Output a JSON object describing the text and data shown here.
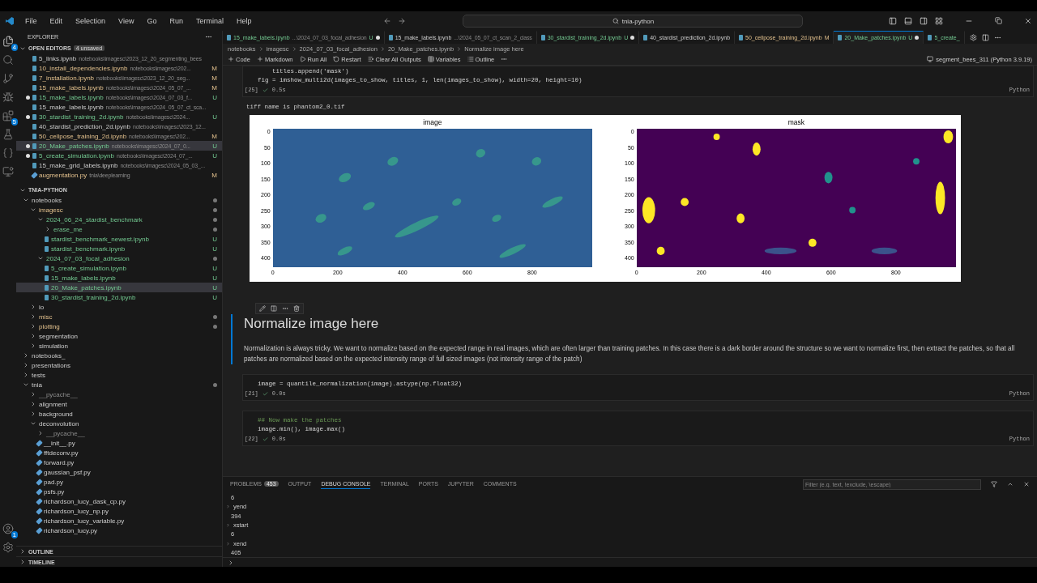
{
  "menu": [
    "File",
    "Edit",
    "Selection",
    "View",
    "Go",
    "Run",
    "Terminal",
    "Help"
  ],
  "search": "tnia-python",
  "activity": [
    {
      "kind": "files",
      "badge": "4",
      "selected": true
    },
    {
      "kind": "search",
      "selected": false
    },
    {
      "kind": "git",
      "selected": false
    },
    {
      "kind": "debug",
      "selected": false
    },
    {
      "kind": "extensions",
      "badge": "5",
      "selected": false
    },
    {
      "kind": "testing",
      "selected": false
    },
    {
      "kind": "json",
      "selected": false
    },
    {
      "kind": "remote",
      "selected": false
    }
  ],
  "activity_bottom": [
    {
      "kind": "account",
      "badge": "1"
    },
    {
      "kind": "settings"
    }
  ],
  "explorer": {
    "title": "EXPLORER",
    "open_editors": {
      "title": "OPEN EDITORS",
      "badge": "4 unsaved",
      "items": [
        {
          "name": "5_links.ipynb",
          "path": "notebooks\\imagesc\\2023_12_20_segmenting_bees",
          "kind": "notebook",
          "unsaved": false,
          "selected": false,
          "untracked": false,
          "modified": false
        },
        {
          "name": "10_install_dependencies.ipynb",
          "path": "notebooks\\imagesc\\202...",
          "status": "M",
          "kind": "notebook",
          "unsaved": false,
          "selected": false,
          "untracked": false,
          "modified": true
        },
        {
          "name": "7_installation.ipynb",
          "path": "notebooks\\imagesc\\2023_12_20_seg...",
          "status": "M",
          "kind": "notebook",
          "unsaved": false,
          "selected": false,
          "untracked": false,
          "modified": true
        },
        {
          "name": "15_make_labels.ipynb",
          "path": "notebooks\\imagesc\\2024_05_07_...",
          "status": "M",
          "kind": "notebook",
          "unsaved": false,
          "selected": false,
          "untracked": false,
          "modified": true
        },
        {
          "name": "15_make_labels.ipynb",
          "path": "notebooks\\imagesc\\2024_07_03_f...",
          "status": "U",
          "kind": "notebook",
          "unsaved": true,
          "selected": false,
          "untracked": true
        },
        {
          "name": "15_make_labels.ipynb",
          "path": "notebooks\\imagesc\\2024_05_07_ct_sca...",
          "kind": "notebook",
          "unsaved": false,
          "selected": false,
          "untracked": false,
          "modified": false
        },
        {
          "name": "30_stardist_training_2d.ipynb",
          "path": "notebooks\\imagesc\\2024...",
          "status": "U",
          "kind": "notebook",
          "unsaved": true,
          "selected": false,
          "untracked": true
        },
        {
          "name": "40_stardist_prediction_2d.ipynb",
          "path": "notebooks\\imagesc\\2023_12...",
          "kind": "notebook",
          "unsaved": false,
          "selected": false,
          "untracked": false,
          "modified": false
        },
        {
          "name": "50_cellpose_training_2d.ipynb",
          "path": "notebooks\\imagesc\\202...",
          "status": "M",
          "kind": "notebook",
          "unsaved": false,
          "selected": false,
          "untracked": false,
          "modified": true
        },
        {
          "name": "20_Make_patches.ipynb",
          "path": "notebooks\\imagesc\\2024_07_0...",
          "status": "U",
          "kind": "notebook",
          "unsaved": true,
          "selected": true,
          "untracked": true
        },
        {
          "name": "5_create_simulation.ipynb",
          "path": "notebooks\\imagesc\\2024_07_...",
          "status": "U",
          "kind": "notebook",
          "unsaved": true,
          "selected": false,
          "untracked": true
        },
        {
          "name": "15_make_grid_labels.ipynb",
          "path": "notebooks\\imagesc\\2024_05_03_...",
          "kind": "notebook",
          "unsaved": false,
          "selected": false,
          "untracked": false,
          "modified": false
        },
        {
          "name": "augmentation.py",
          "path": "tnia\\deeplearning",
          "status": "M",
          "kind": "python",
          "unsaved": false,
          "selected": false,
          "untracked": false,
          "modified": true
        }
      ]
    },
    "project": {
      "title": "TNIA-PYTHON",
      "tree": [
        {
          "name": "notebooks",
          "kind": "folder",
          "expanded": true,
          "dot": true,
          "untracked": false,
          "modified": false,
          "ignored": false,
          "selected": false,
          "children": [
            {
              "name": "imagesc",
              "kind": "folder",
              "expanded": true,
              "dot": true,
              "untracked": false,
              "modified": true,
              "selected": false,
              "children": [
                {
                  "name": "2024_06_24_stardist_benchmark",
                  "kind": "folder",
                  "expanded": true,
                  "dot": true,
                  "untracked": true,
                  "selected": false,
                  "children": [
                    {
                      "name": "erase_me",
                      "kind": "folder",
                      "expanded": false,
                      "dot": true,
                      "untracked": true,
                      "selected": false
                    },
                    {
                      "name": "stardist_benchmark_newest.ipynb",
                      "kind": "notebook",
                      "status": "U",
                      "untracked": true,
                      "selected": false
                    },
                    {
                      "name": "stardist_benchmark.ipynb",
                      "kind": "notebook",
                      "status": "U",
                      "untracked": true,
                      "selected": false
                    }
                  ]
                },
                {
                  "name": "2024_07_03_focal_adhesion",
                  "kind": "folder",
                  "expanded": true,
                  "dot": true,
                  "untracked": true,
                  "selected": false,
                  "children": [
                    {
                      "name": "5_create_simulation.ipynb",
                      "kind": "notebook",
                      "status": "U",
                      "untracked": true,
                      "selected": false
                    },
                    {
                      "name": "15_make_labels.ipynb",
                      "kind": "notebook",
                      "status": "U",
                      "untracked": true,
                      "selected": false
                    },
                    {
                      "name": "20_Make_patches.ipynb",
                      "kind": "notebook",
                      "status": "U",
                      "untracked": true,
                      "selected": true
                    },
                    {
                      "name": "30_stardist_training_2d.ipynb",
                      "kind": "notebook",
                      "status": "U",
                      "untracked": true,
                      "selected": false
                    }
                  ]
                }
              ]
            },
            {
              "name": "io",
              "kind": "folder",
              "expanded": false,
              "dot": false,
              "untracked": false,
              "modified": false,
              "ignored": false,
              "selected": false
            },
            {
              "name": "misc",
              "kind": "folder",
              "expanded": false,
              "dot": true,
              "untracked": false,
              "modified": true,
              "selected": false
            },
            {
              "name": "plotting",
              "kind": "folder",
              "expanded": false,
              "dot": true,
              "untracked": false,
              "modified": true,
              "selected": false
            },
            {
              "name": "segmentation",
              "kind": "folder",
              "expanded": false,
              "dot": false,
              "untracked": false,
              "modified": false,
              "ignored": false,
              "selected": false
            },
            {
              "name": "simulation",
              "kind": "folder",
              "expanded": false,
              "dot": false,
              "untracked": false,
              "modified": false,
              "ignored": false,
              "selected": false
            }
          ]
        },
        {
          "name": "notebooks_",
          "kind": "folder",
          "expanded": false,
          "dot": false,
          "untracked": false,
          "modified": false,
          "ignored": false,
          "selected": false
        },
        {
          "name": "presentations",
          "kind": "folder",
          "expanded": false,
          "dot": false,
          "untracked": false,
          "modified": false,
          "ignored": false,
          "selected": false
        },
        {
          "name": "tests",
          "kind": "folder",
          "expanded": false,
          "dot": false,
          "untracked": false,
          "modified": false,
          "ignored": false,
          "selected": false
        },
        {
          "name": "tnia",
          "kind": "folder",
          "expanded": true,
          "dot": true,
          "untracked": false,
          "modified": false,
          "ignored": false,
          "selected": false,
          "children": [
            {
              "name": "__pycache__",
              "kind": "folder",
              "expanded": false,
              "dot": false,
              "untracked": false,
              "modified": false,
              "ignored": true,
              "selected": false
            },
            {
              "name": "alignment",
              "kind": "folder",
              "expanded": false,
              "dot": false,
              "untracked": false,
              "modified": false,
              "ignored": false,
              "selected": false
            },
            {
              "name": "background",
              "kind": "folder",
              "expanded": false,
              "dot": false,
              "untracked": false,
              "modified": false,
              "ignored": false,
              "selected": false
            },
            {
              "name": "deconvolution",
              "kind": "folder",
              "expanded": true,
              "dot": false,
              "untracked": false,
              "modified": false,
              "ignored": false,
              "selected": false,
              "children": [
                {
                  "name": "__pycache__",
                  "kind": "folder",
                  "expanded": false,
                  "dot": false,
                  "untracked": false,
                  "modified": false,
                  "ignored": true,
                  "selected": false
                },
                {
                  "name": "__init__.py",
                  "kind": "python",
                  "untracked": false,
                  "modified": false,
                  "ignored": false,
                  "selected": false
                },
                {
                  "name": "fftdeconv.py",
                  "kind": "python",
                  "untracked": false,
                  "modified": false,
                  "ignored": false,
                  "selected": false
                },
                {
                  "name": "forward.py",
                  "kind": "python",
                  "untracked": false,
                  "modified": false,
                  "ignored": false,
                  "selected": false
                },
                {
                  "name": "gaussian_psf.py",
                  "kind": "python",
                  "untracked": false,
                  "modified": false,
                  "ignored": false,
                  "selected": false
                },
                {
                  "name": "pad.py",
                  "kind": "python",
                  "untracked": false,
                  "modified": false,
                  "ignored": false,
                  "selected": false
                },
                {
                  "name": "psfs.py",
                  "kind": "python",
                  "untracked": false,
                  "modified": false,
                  "ignored": false,
                  "selected": false
                },
                {
                  "name": "richardson_lucy_dask_cp.py",
                  "kind": "python",
                  "untracked": false,
                  "modified": false,
                  "ignored": false,
                  "selected": false
                },
                {
                  "name": "richardson_lucy_np.py",
                  "kind": "python",
                  "untracked": false,
                  "modified": false,
                  "ignored": false,
                  "selected": false
                },
                {
                  "name": "richardson_lucy_variable.py",
                  "kind": "python",
                  "untracked": false,
                  "modified": false,
                  "ignored": false,
                  "selected": false
                },
                {
                  "name": "richardson_lucy.py",
                  "kind": "python",
                  "untracked": false,
                  "modified": false,
                  "ignored": false,
                  "selected": false
                }
              ]
            }
          ]
        }
      ]
    },
    "outline": "OUTLINE",
    "timeline": "TIMELINE"
  },
  "tabs": [
    {
      "label": "15_make_labels.ipynb",
      "path": "...\\2024_07_03_focal_adhesion",
      "status": "U",
      "unsaved": true,
      "selected": false,
      "untracked": true
    },
    {
      "label": "15_make_labels.ipynb",
      "path": "...\\2024_05_07_ct_scan_2_class",
      "unsaved": false,
      "selected": false,
      "untracked": false,
      "modified": false
    },
    {
      "label": "30_stardist_training_2d.ipynb",
      "status": "U",
      "unsaved": true,
      "selected": false,
      "untracked": true
    },
    {
      "label": "40_stardist_prediction_2d.ipynb",
      "unsaved": false,
      "selected": false,
      "untracked": false,
      "modified": false
    },
    {
      "label": "50_cellpose_training_2d.ipynb",
      "status": "M",
      "unsaved": false,
      "selected": false,
      "untracked": false,
      "modified": true
    },
    {
      "label": "20_Make_patches.ipynb",
      "status": "U",
      "unsaved": true,
      "selected": true,
      "untracked": true
    },
    {
      "label": "5_create_",
      "unsaved": false,
      "selected": false,
      "untracked": true
    }
  ],
  "breadcrumb": [
    "notebooks",
    "imagesc",
    "2024_07_03_focal_adhesion",
    "20_Make_patches.ipynb",
    "Normalize image here"
  ],
  "toolbar": [
    {
      "kind": "add",
      "label": "Code"
    },
    {
      "kind": "add",
      "label": "Markdown"
    },
    {
      "kind": "run",
      "label": "Run All"
    },
    {
      "kind": "restart",
      "label": "Restart"
    },
    {
      "kind": "clear",
      "label": "Clear All Outputs"
    },
    {
      "kind": "variables",
      "label": "Variables"
    },
    {
      "kind": "outline",
      "label": "Outline"
    }
  ],
  "kernel": "segment_bees_311 (Python 3.9.19)",
  "cells": [
    {
      "kind": "code",
      "lines": [
        "    titles.append('mask')",
        "fig = imshow_multi2d(images_to_show, titles, 1, len(images_to_show), width=20, height=10)"
      ],
      "count": "[25]",
      "time": "0.5s",
      "language": "Python",
      "output": "tiff name is phantom2_0.tif",
      "figure": [
        {
          "title": "image",
          "yticks": [
            "0",
            "50",
            "100",
            "150",
            "200",
            "250",
            "300",
            "350",
            "400"
          ],
          "xticks": [
            "0",
            "200",
            "400",
            "600",
            "800"
          ]
        },
        {
          "title": "mask",
          "kind": "mask",
          "yticks": [
            "0",
            "50",
            "100",
            "150",
            "200",
            "250",
            "300",
            "350",
            "400"
          ],
          "xticks": [
            "0",
            "200",
            "400",
            "600",
            "800"
          ]
        }
      ]
    },
    {
      "kind": "markdown",
      "heading": "Normalize image here",
      "text": "Normalization is always tricky. We want to normalize based on the expected range in real images, which are often larger than training patches. In this case there is a dark border around the structure so we want to normalize first, then extract the patches, so that all patches are normalized based on the expected intensity range of full sized images (not intensity range of the patch)"
    },
    {
      "kind": "code",
      "lines": [
        "image = quantile_normalization(image).astype(np.float32)"
      ],
      "count": "[21]",
      "time": "0.0s",
      "language": "Python"
    },
    {
      "kind": "code",
      "lines": [
        "## Now make the patches",
        "image.min(), image.max()"
      ],
      "count": "[22]",
      "time": "0.0s",
      "language": "Python"
    }
  ],
  "panel": {
    "tabs": [
      {
        "label": "PROBLEMS",
        "badge": "453",
        "selected": false
      },
      {
        "label": "OUTPUT",
        "selected": false
      },
      {
        "label": "DEBUG CONSOLE",
        "selected": true
      },
      {
        "label": "TERMINAL",
        "selected": false
      },
      {
        "label": "PORTS",
        "selected": false
      },
      {
        "label": "JUPYTER",
        "selected": false
      },
      {
        "label": "COMMENTS",
        "selected": false
      }
    ],
    "filter_placeholder": "Filter (e.g. text, !exclude, \\escape)",
    "console": [
      {
        "text": "6",
        "kind": "output"
      },
      {
        "text": "yend",
        "kind": "input"
      },
      {
        "text": "394",
        "kind": "output"
      },
      {
        "text": "xstart",
        "kind": "input"
      },
      {
        "text": "6",
        "kind": "output"
      },
      {
        "text": "xend",
        "kind": "input"
      },
      {
        "text": "405",
        "kind": "output"
      }
    ]
  }
}
